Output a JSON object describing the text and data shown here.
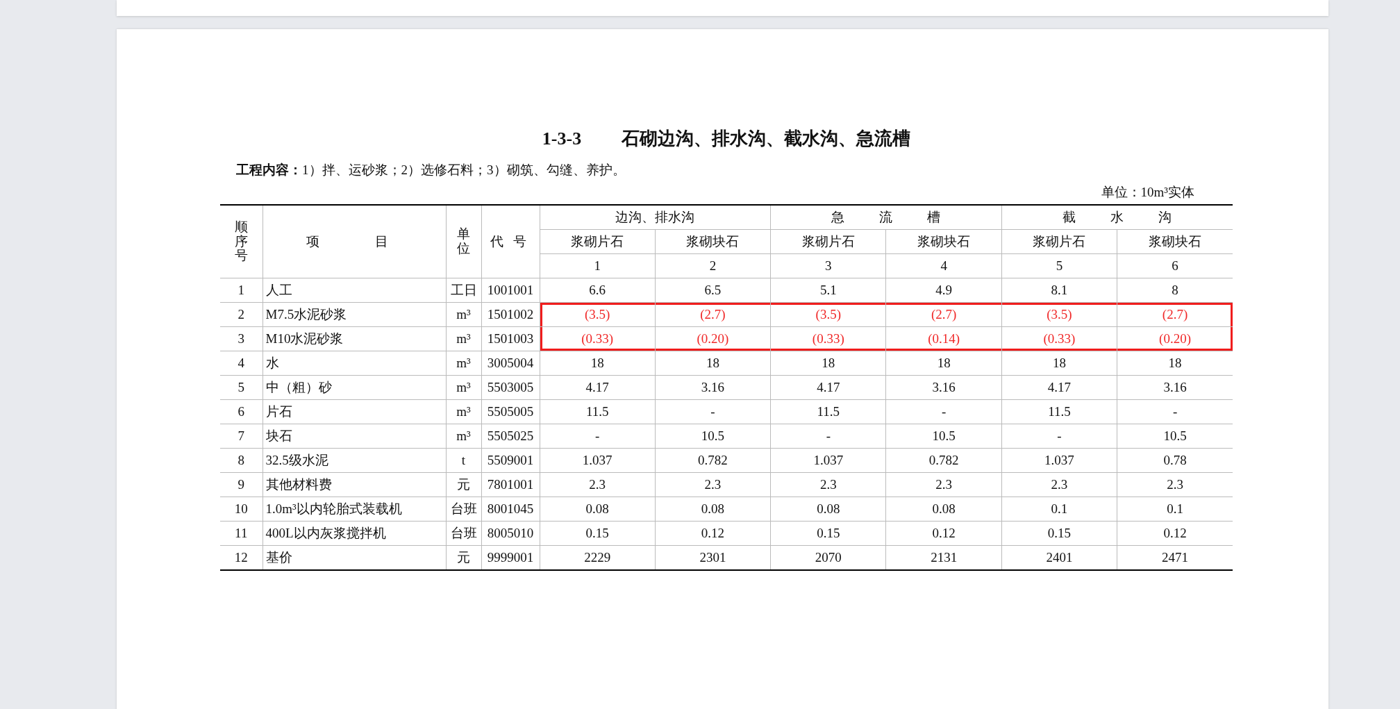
{
  "document": {
    "number": "1-3-3",
    "title": "石砌边沟、排水沟、截水沟、急流槽",
    "work_label": "工程内容：",
    "work_text": "1）拌、运砂浆；2）选修石料；3）砌筑、勾缝、养护。",
    "unit_note": "单位：10m³实体"
  },
  "table": {
    "columns": [
      "顺序号",
      "项目",
      "单位",
      "代号"
    ],
    "groups": [
      {
        "label": "边沟、排水沟",
        "subcolumns": [
          {
            "label": "浆砌片石",
            "number": "1"
          },
          {
            "label": "浆砌块石",
            "number": "2"
          }
        ]
      },
      {
        "label": "急流槽",
        "subcolumns": [
          {
            "label": "浆砌片石",
            "number": "3"
          },
          {
            "label": "浆砌块石",
            "number": "4"
          }
        ]
      },
      {
        "label": "截水沟",
        "subcolumns": [
          {
            "label": "浆砌片石",
            "number": "5"
          },
          {
            "label": "浆砌块石",
            "number": "6"
          }
        ]
      }
    ],
    "rows": [
      {
        "seq": "1",
        "item": "人工",
        "unit": "工日",
        "code": "1001001",
        "values": [
          "6.6",
          "6.5",
          "5.1",
          "4.9",
          "8.1",
          "8"
        ],
        "highlighted": false
      },
      {
        "seq": "2",
        "item": "M7.5水泥砂浆",
        "unit": "m³",
        "code": "1501002",
        "values": [
          "(3.5)",
          "(2.7)",
          "(3.5)",
          "(2.7)",
          "(3.5)",
          "(2.7)"
        ],
        "highlighted": true
      },
      {
        "seq": "3",
        "item": "M10水泥砂浆",
        "unit": "m³",
        "code": "1501003",
        "values": [
          "(0.33)",
          "(0.20)",
          "(0.33)",
          "(0.14)",
          "(0.33)",
          "(0.20)"
        ],
        "highlighted": true
      },
      {
        "seq": "4",
        "item": "水",
        "unit": "m³",
        "code": "3005004",
        "values": [
          "18",
          "18",
          "18",
          "18",
          "18",
          "18"
        ],
        "highlighted": false
      },
      {
        "seq": "5",
        "item": "中（粗）砂",
        "unit": "m³",
        "code": "5503005",
        "values": [
          "4.17",
          "3.16",
          "4.17",
          "3.16",
          "4.17",
          "3.16"
        ],
        "highlighted": false
      },
      {
        "seq": "6",
        "item": "片石",
        "unit": "m³",
        "code": "5505005",
        "values": [
          "11.5",
          "-",
          "11.5",
          "-",
          "11.5",
          "-"
        ],
        "highlighted": false
      },
      {
        "seq": "7",
        "item": "块石",
        "unit": "m³",
        "code": "5505025",
        "values": [
          "-",
          "10.5",
          "-",
          "10.5",
          "-",
          "10.5"
        ],
        "highlighted": false
      },
      {
        "seq": "8",
        "item": "32.5级水泥",
        "unit": "t",
        "code": "5509001",
        "values": [
          "1.037",
          "0.782",
          "1.037",
          "0.782",
          "1.037",
          "0.78"
        ],
        "highlighted": false
      },
      {
        "seq": "9",
        "item": "其他材料费",
        "unit": "元",
        "code": "7801001",
        "values": [
          "2.3",
          "2.3",
          "2.3",
          "2.3",
          "2.3",
          "2.3"
        ],
        "highlighted": false
      },
      {
        "seq": "10",
        "item": "1.0m³以内轮胎式装载机",
        "unit": "台班",
        "code": "8001045",
        "values": [
          "0.08",
          "0.08",
          "0.08",
          "0.08",
          "0.1",
          "0.1"
        ],
        "highlighted": false
      },
      {
        "seq": "11",
        "item": "400L以内灰浆搅拌机",
        "unit": "台班",
        "code": "8005010",
        "values": [
          "0.15",
          "0.12",
          "0.15",
          "0.12",
          "0.15",
          "0.12"
        ],
        "highlighted": false
      },
      {
        "seq": "12",
        "item": "基价",
        "unit": "元",
        "code": "9999001",
        "values": [
          "2229",
          "2301",
          "2070",
          "2131",
          "2401",
          "2471"
        ],
        "highlighted": false
      }
    ]
  }
}
